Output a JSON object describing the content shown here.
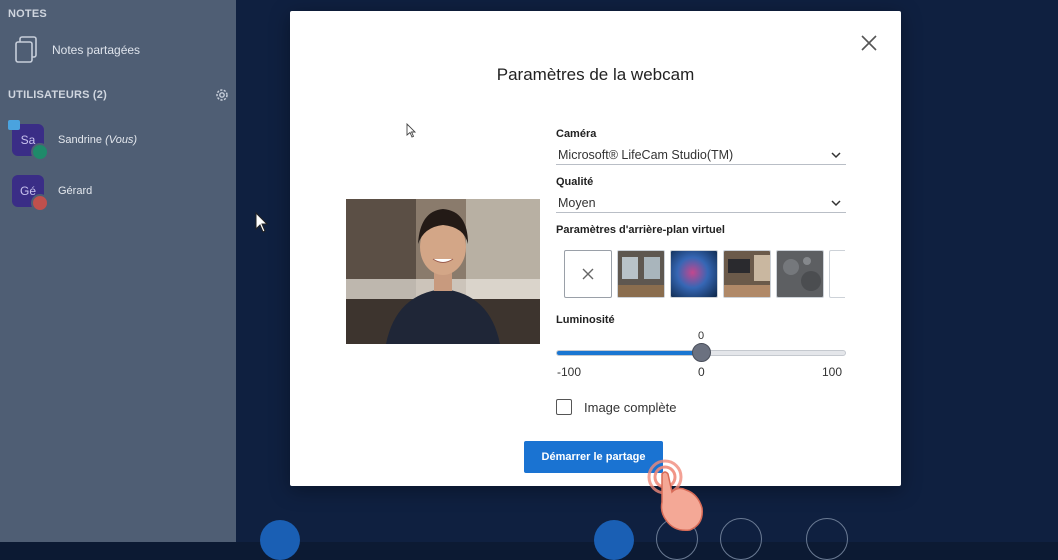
{
  "sidebar": {
    "notes_header": "NOTES",
    "shared_notes_label": "Notes partagées",
    "users_header": "UTILISATEURS (2)",
    "users": [
      {
        "initials": "Sa",
        "name": "Sandrine",
        "suffix": "(Vous)",
        "avatar_color": "#3a2d86",
        "badge_color": "#1f8a6a"
      },
      {
        "initials": "Gé",
        "name": "Gérard",
        "suffix": "",
        "avatar_color": "#3a2d86",
        "badge_color": "#c0504d"
      }
    ]
  },
  "modal": {
    "title": "Paramètres de la webcam",
    "camera_label": "Caméra",
    "camera_value": "Microsoft® LifeCam Studio(TM)",
    "quality_label": "Qualité",
    "quality_value": "Moyen",
    "bg_label": "Paramètres d'arrière-plan virtuel",
    "bg_options": [
      "none-icon",
      "office-room",
      "blue-abstract",
      "living-room",
      "grey-texture",
      "white"
    ],
    "brightness_label": "Luminosité",
    "brightness": {
      "value": "0",
      "min": "-100",
      "mid": "0",
      "max": "100",
      "fraction": 0.5
    },
    "fullscreen_label": "Image complète",
    "fullscreen_checked": false,
    "start_button": "Démarrer le partage"
  },
  "colors": {
    "accent": "#1a73d2",
    "sidebar_bg": "#4f5e74",
    "main_bg": "#0f2040"
  }
}
